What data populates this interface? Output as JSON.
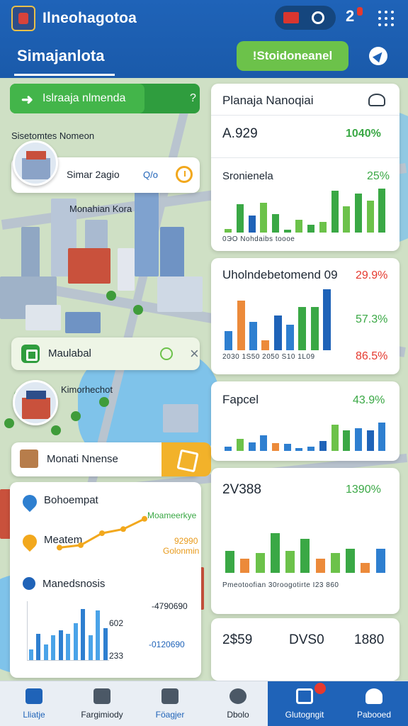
{
  "header": {
    "app_title": "Ilneohagotoa",
    "status_pill_text": "··",
    "notification_count": "2",
    "page_title": "Simajanlota",
    "cta_label": "!Stoidoneanel"
  },
  "map": {
    "route_bar_label": "Islraaja nlmenda",
    "route_bar_chevron": "?",
    "caption_top": "Sisetomtes Nomeon",
    "caption_mid": "Monahian Kora",
    "place_name": "Simar 2agio",
    "place_meta": "Q/o",
    "info_label": "Maulabal",
    "info_close": "×",
    "location_caption": "Kimorhechot",
    "house_label": "Monati Nnense"
  },
  "metrics": {
    "row1_label": "Bohoempat",
    "row1_tag": "Moameerkye",
    "row2_label": "Meatem",
    "row2_value": "92990",
    "row2_sub": "Golonmin",
    "row3_label": "Manedsnosis",
    "scale_top": "-4790690",
    "scale_mid_left": "602",
    "scale_mid": "-0120690",
    "scale_bottom": "233",
    "line_points": [
      20,
      26,
      55,
      65,
      90
    ],
    "bars": [
      12,
      30,
      18,
      28,
      34,
      30,
      42,
      58,
      28,
      56,
      36
    ]
  },
  "panels": {
    "p1": {
      "title": "Planaja Nanoqiai",
      "value": "A.929",
      "value_pct": "1040%",
      "sub_title": "Sronienela",
      "sub_pct": "25%",
      "axis_label": "0ЭO   Nohdaibs toooe",
      "bars": [
        {
          "v": 8,
          "c": "#6cc24a"
        },
        {
          "v": 60,
          "c": "#3aa845"
        },
        {
          "v": 36,
          "c": "#1f63b8"
        },
        {
          "v": 64,
          "c": "#6cc24a"
        },
        {
          "v": 40,
          "c": "#3aa845"
        },
        {
          "v": 6,
          "c": "#3aa845"
        },
        {
          "v": 28,
          "c": "#6cc24a"
        },
        {
          "v": 16,
          "c": "#3aa845"
        },
        {
          "v": 22,
          "c": "#6cc24a"
        },
        {
          "v": 90,
          "c": "#3aa845"
        },
        {
          "v": 56,
          "c": "#6cc24a"
        },
        {
          "v": 84,
          "c": "#3aa845"
        },
        {
          "v": 68,
          "c": "#6cc24a"
        },
        {
          "v": 94,
          "c": "#3aa845"
        }
      ]
    },
    "p2": {
      "title": "Uholndebetomend 09",
      "pct1": "29.9%",
      "pct2": "57.3%",
      "pct3": "86.5%",
      "axis_label": "2030  1S50  2050   S10  1L09",
      "bars": [
        {
          "v": 30,
          "c": "#2e7fd0"
        },
        {
          "v": 78,
          "c": "#ec8a3a"
        },
        {
          "v": 44,
          "c": "#2e7fd0"
        },
        {
          "v": 16,
          "c": "#ec8a3a"
        },
        {
          "v": 54,
          "c": "#1f63b8"
        },
        {
          "v": 40,
          "c": "#2e7fd0"
        },
        {
          "v": 68,
          "c": "#3aa845"
        },
        {
          "v": 68,
          "c": "#3aa845"
        },
        {
          "v": 96,
          "c": "#1f63b8"
        }
      ]
    },
    "p3": {
      "title": "Fapcel",
      "pct": "43.9%",
      "bars": [
        {
          "v": 10,
          "c": "#2e7fd0"
        },
        {
          "v": 28,
          "c": "#6cc24a"
        },
        {
          "v": 20,
          "c": "#2e7fd0"
        },
        {
          "v": 36,
          "c": "#2e7fd0"
        },
        {
          "v": 18,
          "c": "#ec8a3a"
        },
        {
          "v": 16,
          "c": "#2e7fd0"
        },
        {
          "v": 6,
          "c": "#2e7fd0"
        },
        {
          "v": 10,
          "c": "#2e7fd0"
        },
        {
          "v": 22,
          "c": "#1f63b8"
        },
        {
          "v": 60,
          "c": "#6cc24a"
        },
        {
          "v": 46,
          "c": "#3aa845"
        },
        {
          "v": 52,
          "c": "#2e7fd0"
        },
        {
          "v": 46,
          "c": "#1f63b8"
        },
        {
          "v": 64,
          "c": "#2e7fd0"
        }
      ]
    },
    "p4": {
      "title": "2V388",
      "pct": "1390%",
      "axis_label": "Pmeotoofian  30roogotirte  I23 860",
      "bars": [
        {
          "v": 40,
          "c": "#3aa845"
        },
        {
          "v": 26,
          "c": "#ec8a3a"
        },
        {
          "v": 36,
          "c": "#6cc24a"
        },
        {
          "v": 72,
          "c": "#3aa845"
        },
        {
          "v": 40,
          "c": "#6cc24a"
        },
        {
          "v": 62,
          "c": "#3aa845"
        },
        {
          "v": 26,
          "c": "#ec8a3a"
        },
        {
          "v": 36,
          "c": "#6cc24a"
        },
        {
          "v": 44,
          "c": "#3aa845"
        },
        {
          "v": 18,
          "c": "#ec8a3a"
        },
        {
          "v": 44,
          "c": "#2e7fd0"
        }
      ]
    },
    "p5": {
      "v1": "2$59",
      "v2": "DVS0",
      "v3": "1880"
    }
  },
  "bottom_nav": [
    {
      "label": "Lliatje"
    },
    {
      "label": "Fargimiody"
    },
    {
      "label": "Föagjer"
    },
    {
      "label": "Dbolo"
    },
    {
      "label": "Glutogngit"
    },
    {
      "label": "Pabooed"
    }
  ],
  "colors": {
    "brand_blue": "#1f63b8",
    "accent_green": "#6cc24a",
    "accent_orange": "#f2a81d",
    "alert_red": "#e53a2f"
  }
}
